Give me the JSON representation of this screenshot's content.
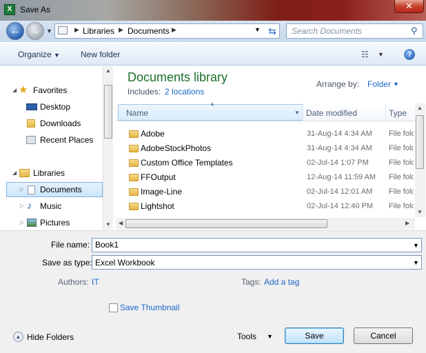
{
  "window": {
    "title": "Save As",
    "close_label": "✕",
    "app_icon": "X"
  },
  "address": {
    "crumbs": [
      "Libraries",
      "Documents"
    ],
    "search_placeholder": "Search Documents"
  },
  "toolbar": {
    "organize": "Organize",
    "new_folder": "New folder"
  },
  "nav": {
    "favorites": "Favorites",
    "fav_items": [
      "Desktop",
      "Downloads",
      "Recent Places"
    ],
    "libraries": "Libraries",
    "lib_items": [
      "Documents",
      "Music",
      "Pictures"
    ]
  },
  "library": {
    "title": "Documents library",
    "includes_label": "Includes:",
    "locations": "2 locations",
    "arrange_label": "Arrange by:",
    "arrange_value": "Folder"
  },
  "columns": {
    "name": "Name",
    "date": "Date modified",
    "type": "Type"
  },
  "files": [
    {
      "name": "Adobe",
      "date": "31-Aug-14 4:34 AM",
      "type": "File folder"
    },
    {
      "name": "AdobeStockPhotos",
      "date": "31-Aug-14 4:34 AM",
      "type": "File folder"
    },
    {
      "name": "Custom Office Templates",
      "date": "02-Jul-14 1:07 PM",
      "type": "File folder"
    },
    {
      "name": "FFOutput",
      "date": "12-Aug-14 11:59 AM",
      "type": "File folder"
    },
    {
      "name": "Image-Line",
      "date": "02-Jul-14 12:01 AM",
      "type": "File folder"
    },
    {
      "name": "Lightshot",
      "date": "02-Jul-14 12:40 PM",
      "type": "File folder"
    }
  ],
  "form": {
    "file_name_label": "File name:",
    "file_name": "Book1",
    "save_type_label": "Save as type:",
    "save_type": "Excel Workbook",
    "authors_label": "Authors:",
    "authors": "IT",
    "tags_label": "Tags:",
    "tags": "Add a tag",
    "thumbnail_label": "Save Thumbnail",
    "thumbnail_checked": false
  },
  "footer": {
    "hide_folders": "Hide Folders",
    "tools": "Tools",
    "save": "Save",
    "cancel": "Cancel"
  }
}
